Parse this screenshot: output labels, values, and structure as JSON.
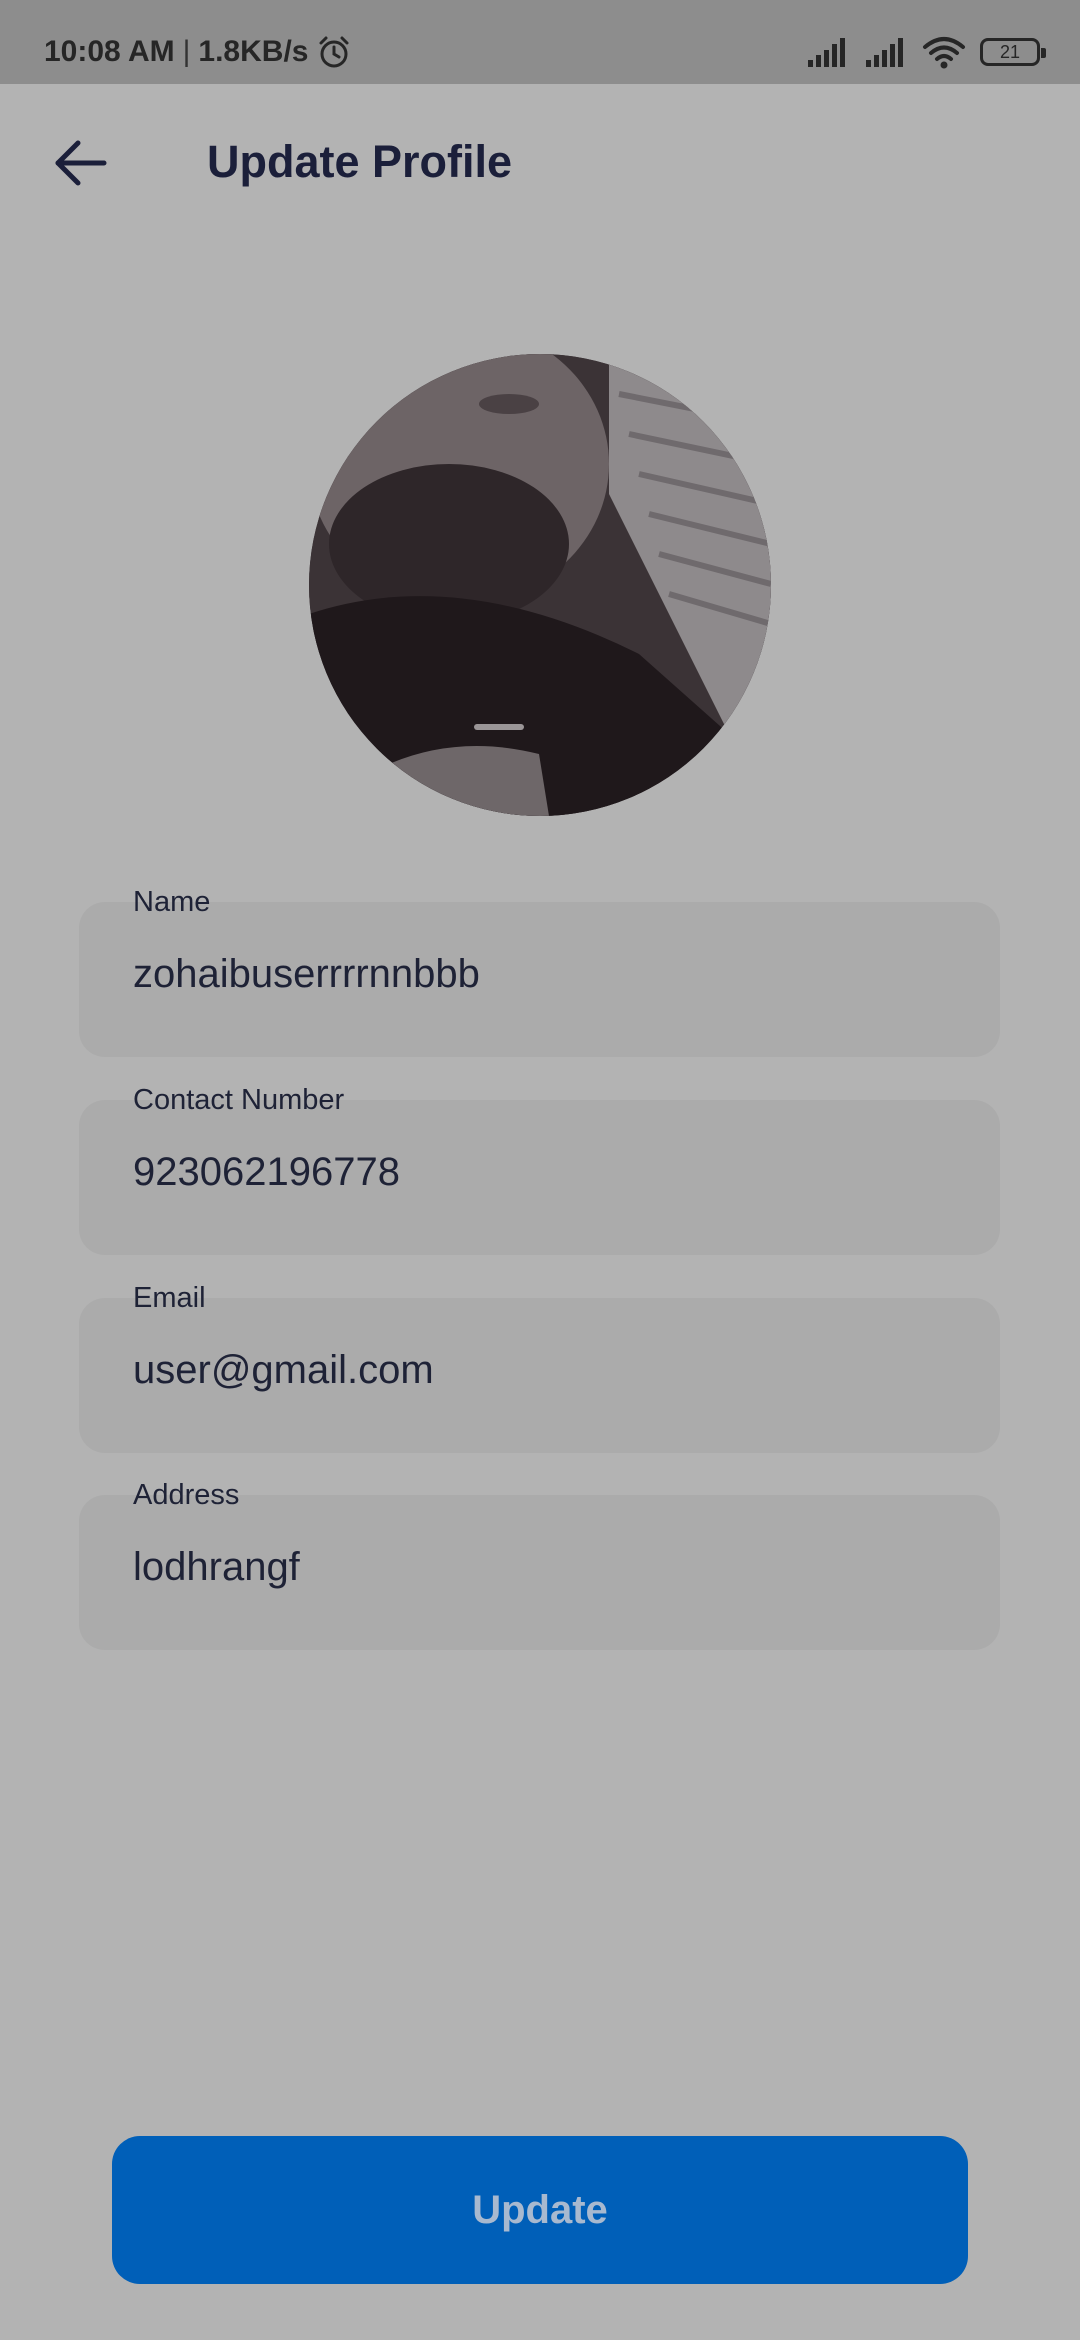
{
  "status_bar": {
    "time": "10:08 AM",
    "separator": "|",
    "network_speed": "1.8KB/s",
    "battery_level": "21",
    "icons": [
      "alarm-icon",
      "signal-icon",
      "signal-icon",
      "wifi-icon",
      "battery-icon"
    ]
  },
  "header": {
    "back_icon": "arrow-left-icon",
    "title": "Update Profile"
  },
  "profile": {
    "avatar": "profile-photo"
  },
  "form": {
    "name": {
      "label": "Name",
      "value": "zohaibuserrrrnnbbb"
    },
    "contact": {
      "label": "Contact Number",
      "value": "923062196778"
    },
    "email": {
      "label": "Email",
      "value": "user@gmail.com"
    },
    "address": {
      "label": "Address",
      "value": "lodhrangf"
    }
  },
  "actions": {
    "update_label": "Update"
  },
  "colors": {
    "background": "#b3b3b3",
    "field_background": "#ababab",
    "text_dark": "#1e2236",
    "button": "#005fb8",
    "button_text": "#a8b9cf"
  }
}
